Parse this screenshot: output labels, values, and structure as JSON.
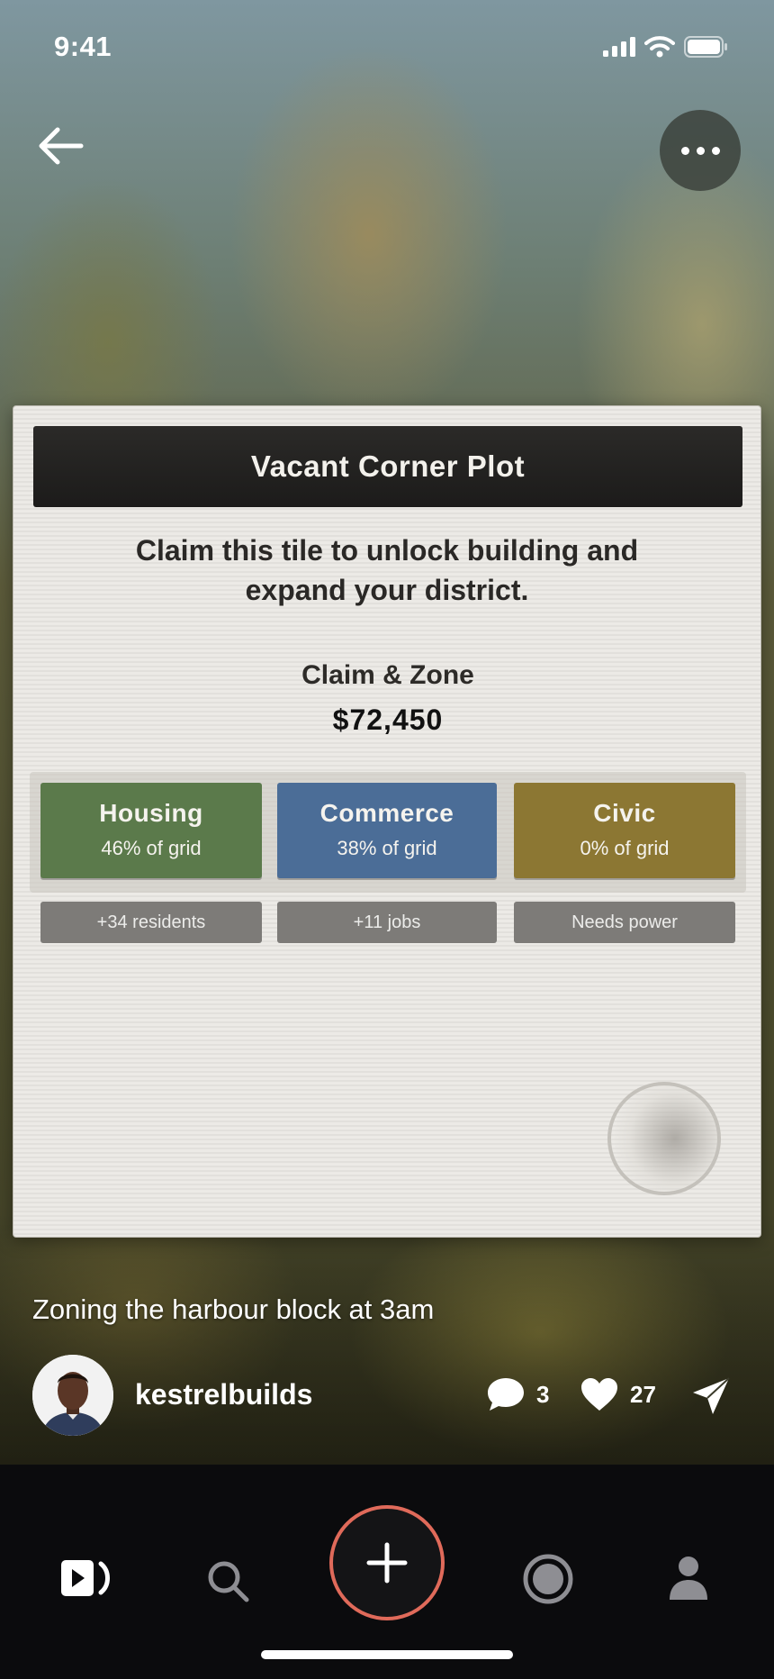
{
  "status": {
    "time": "9:41"
  },
  "card": {
    "title": "Vacant Corner Plot",
    "description": "Claim this tile to unlock building and expand your district.",
    "claim_label": "Claim & Zone",
    "price": "$72,450",
    "zones": [
      {
        "name": "Housing",
        "share": "46% of grid",
        "color": "#5b7a4b",
        "effect": "+34 residents"
      },
      {
        "name": "Commerce",
        "share": "38% of grid",
        "color": "#4b6d97",
        "effect": "+11 jobs"
      },
      {
        "name": "Civic",
        "share": "0% of grid",
        "color": "#8c7733",
        "effect": "Needs power"
      }
    ]
  },
  "post": {
    "caption": "Zoning the harbour block at 3am",
    "username": "kestrelbuilds",
    "comments": "3",
    "likes": "27"
  },
  "icons": {
    "back": "arrow-left-icon",
    "more": "ellipsis-icon",
    "comment": "speech-bubble-icon",
    "like": "heart-icon",
    "share": "paper-plane-icon",
    "tabs": [
      "feed-play-icon",
      "search-icon",
      "plus-icon",
      "record-icon",
      "profile-icon"
    ]
  },
  "colors": {
    "create_ring": "#e06a5a"
  }
}
